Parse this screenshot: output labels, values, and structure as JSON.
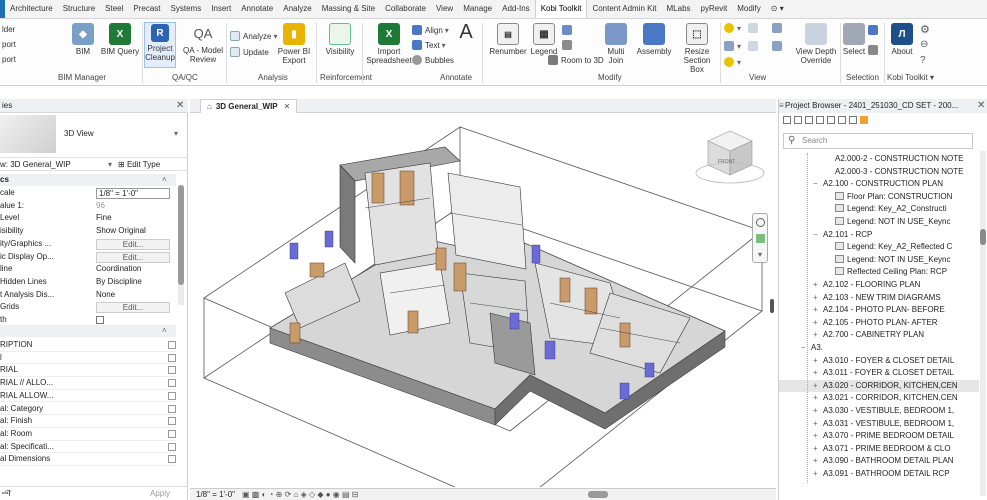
{
  "tabs": [
    "Architecture",
    "Structure",
    "Steel",
    "Precast",
    "Systems",
    "Insert",
    "Annotate",
    "Analyze",
    "Massing & Site",
    "Collaborate",
    "View",
    "Manage",
    "Add-Ins",
    "Kobi Toolkit",
    "Content Admin Kit",
    "MLabs",
    "pyRevit",
    "Modify"
  ],
  "active_tab": "Kobi Toolkit",
  "ribbon": {
    "left_cut": [
      "lder",
      "port",
      "port"
    ],
    "bim_manager": {
      "bim": "BIM",
      "bim_query": "BIM Query",
      "panel": "BIM Manager"
    },
    "qaqc": {
      "project_cleanup_1": "Project",
      "project_cleanup_2": "Cleanup",
      "qa_model_1": "QA - Model",
      "qa_model_2": "Review",
      "qa_glyph": "QA",
      "panel": "QA/QC"
    },
    "analysis": {
      "analyze": "Analyze",
      "update": "Update",
      "powerbi_1": "Power BI",
      "powerbi_2": "Export",
      "panel": "Analysis"
    },
    "reinforcement": {
      "visibility": "Visibility",
      "panel": "Reinforcement"
    },
    "annotate": {
      "import_1": "Import",
      "import_2": "Spreadsheet",
      "align": "Align",
      "text": "Text",
      "bubbles": "Bubbles",
      "panel": "Annotate"
    },
    "modify": {
      "renumber": "Renumber",
      "legend": "Legend",
      "room_to_3d": "Room to 3D",
      "multi_1": "Multi",
      "multi_2": "Join",
      "assembly": "Assembly",
      "resize_1": "Resize",
      "resize_2": "Section Box",
      "panel": "Modify"
    },
    "view": {
      "view_depth_1": "View Depth",
      "view_depth_2": "Override",
      "panel": "View"
    },
    "selection": {
      "select": "Select",
      "panel": "Selection"
    },
    "kobi": {
      "about": "About",
      "panel": "Kobi Toolkit ▾"
    }
  },
  "properties": {
    "header": "ies",
    "type_name": "3D View",
    "view_selector": "w: 3D General_WIP",
    "edit_type": "Edit Type",
    "group": "cs",
    "rows": [
      {
        "k": "cale",
        "v": "1/8\" = 1'-0\"",
        "style": "box"
      },
      {
        "k": "alue  1:",
        "v": "96",
        "style": "dim"
      },
      {
        "k": "Level",
        "v": "Fine",
        "style": "text"
      },
      {
        "k": "isibility",
        "v": "Show Original",
        "style": "text"
      },
      {
        "k": "ity/Graphics ...",
        "v": "Edit...",
        "style": "btn"
      },
      {
        "k": "ic Display Op...",
        "v": "Edit...",
        "style": "btn"
      },
      {
        "k": "line",
        "v": "Coordination",
        "style": "text"
      },
      {
        "k": "Hidden Lines",
        "v": "By Discipline",
        "style": "text"
      },
      {
        "k": "t Analysis Dis...",
        "v": "None",
        "style": "text"
      },
      {
        "k": "Grids",
        "v": "Edit...",
        "style": "btn"
      },
      {
        "k": "th",
        "v": "",
        "style": "check"
      }
    ],
    "data_rows": [
      "RIPTION",
      "l",
      "RIAL",
      "RIAL // ALLO...",
      "RIAL ALLOW...",
      "al: Category",
      "al: Finish",
      "al: Room",
      "al: Specificati...",
      "al Dimensions"
    ],
    "apply": "Apply"
  },
  "view_tab": {
    "title": "3D General_WIP"
  },
  "viewcube": {
    "face": "FRONT"
  },
  "status": {
    "scale": "1/8\" = 1'-0\""
  },
  "browser": {
    "header": "Project Browser - 2401_251030_CD SET - 200...",
    "search_placeholder": "Search",
    "items": [
      {
        "indent": 3,
        "type": "text",
        "label": "A2.000-2 - CONSTRUCTION NOTE"
      },
      {
        "indent": 3,
        "type": "text",
        "label": "A2.000-3 - CONSTRUCTION NOTE"
      },
      {
        "indent": 2,
        "type": "minus",
        "label": "A2.100 - CONSTRUCTION PLAN"
      },
      {
        "indent": 3,
        "type": "leaf",
        "label": "Floor Plan: CONSTRUCTION"
      },
      {
        "indent": 3,
        "type": "leaf",
        "label": "Legend: Key_A2_Constructi"
      },
      {
        "indent": 3,
        "type": "leaf",
        "label": "Legend: NOT IN USE_Keync"
      },
      {
        "indent": 2,
        "type": "minus",
        "label": "A2.101 - RCP"
      },
      {
        "indent": 3,
        "type": "leaf",
        "label": "Legend: Key_A2_Reflected C"
      },
      {
        "indent": 3,
        "type": "leaf",
        "label": "Legend: NOT IN USE_Keync"
      },
      {
        "indent": 3,
        "type": "leaf",
        "label": "Reflected Ceiling Plan: RCP"
      },
      {
        "indent": 2,
        "type": "plus",
        "label": "A2.102 - FLOORING PLAN"
      },
      {
        "indent": 2,
        "type": "plus",
        "label": "A2.103 - NEW TRIM DIAGRAMS"
      },
      {
        "indent": 2,
        "type": "plus",
        "label": "A2.104 - PHOTO PLAN- BEFORE"
      },
      {
        "indent": 2,
        "type": "plus",
        "label": "A2.105 - PHOTO PLAN- AFTER"
      },
      {
        "indent": 2,
        "type": "plus",
        "label": "A2.700 - CABINETRY PLAN"
      },
      {
        "indent": 1,
        "type": "minus",
        "label": "A3."
      },
      {
        "indent": 2,
        "type": "plus",
        "label": "A3.010 - FOYER & CLOSET DETAIL"
      },
      {
        "indent": 2,
        "type": "plus",
        "label": "A3.011 - FOYER & CLOSET DETAIL"
      },
      {
        "indent": 2,
        "type": "plus",
        "label": "A3.020 - CORRIDOR, KITCHEN,CEN"
      },
      {
        "indent": 2,
        "type": "plus",
        "label": "A3.021 - CORRIDOR, KITCHEN,CEN"
      },
      {
        "indent": 2,
        "type": "plus",
        "label": "A3.030 - VESTIBULE, BEDROOM 1,"
      },
      {
        "indent": 2,
        "type": "plus",
        "label": "A3.031 - VESTIBULE, BEDROOM 1,"
      },
      {
        "indent": 2,
        "type": "plus",
        "label": "A3.070 - PRIME BEDROOM DETAIL"
      },
      {
        "indent": 2,
        "type": "plus",
        "label": "A3.071 - PRIME BEDROOM & CLO"
      },
      {
        "indent": 2,
        "type": "plus",
        "label": "A3.090 - BATHROOM DETAIL PLAN"
      },
      {
        "indent": 2,
        "type": "plus",
        "label": "A3.091 - BATHROOM DETAIL RCP"
      }
    ],
    "selected_index": 18
  },
  "colors": {
    "accent": "#1d6fb8",
    "wall": "#9b9b9b",
    "wall_dark": "#6e6e6e",
    "cabinet": "#c99a6a",
    "glass": "#6b6bd6",
    "floor": "#e6e6e6"
  }
}
